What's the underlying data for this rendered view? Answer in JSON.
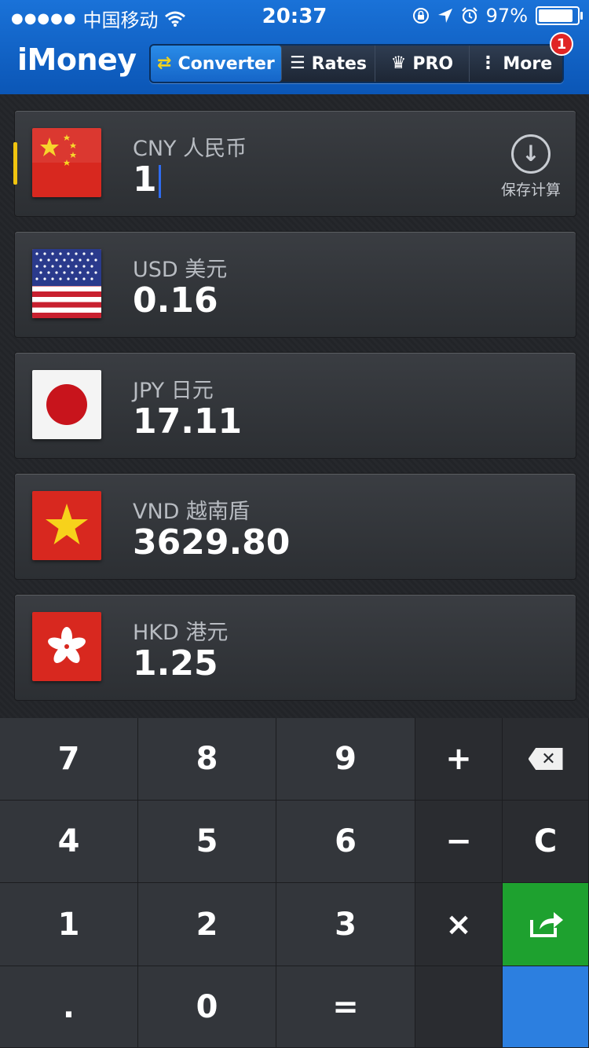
{
  "status": {
    "signal": "●●●●●",
    "carrier": "中国移动",
    "time": "20:37",
    "battery_pct": "97%",
    "battery_level": 0.97
  },
  "header": {
    "title": "iMoney",
    "tabs": [
      {
        "label": "Converter",
        "icon": "swap-icon"
      },
      {
        "label": "Rates",
        "icon": "list-icon"
      },
      {
        "label": "PRO",
        "icon": "crown-icon"
      },
      {
        "label": "More",
        "icon": "vertical-dots-icon"
      }
    ],
    "badge": "1",
    "accent": "#1565c8"
  },
  "save": {
    "label": "保存计算",
    "icon": "download-circle-icon"
  },
  "currencies": [
    {
      "code": "CNY 人民币",
      "value": "1",
      "flag": "china-flag-icon"
    },
    {
      "code": "USD 美元",
      "value": "0.16",
      "flag": "usa-flag-icon"
    },
    {
      "code": "JPY 日元",
      "value": "17.11",
      "flag": "japan-flag-icon"
    },
    {
      "code": "VND 越南盾",
      "value": "3629.80",
      "flag": "vietnam-flag-icon"
    },
    {
      "code": "HKD 港元",
      "value": "1.25",
      "flag": "hongkong-flag-icon"
    }
  ],
  "keypad": {
    "k7": "7",
    "k8": "8",
    "k9": "9",
    "plus": "+",
    "k4": "4",
    "k5": "5",
    "k6": "6",
    "minus": "−",
    "clear": "C",
    "k1": "1",
    "k2": "2",
    "k3": "3",
    "times": "×",
    "dot": ".",
    "k0": "0",
    "equals": "="
  }
}
